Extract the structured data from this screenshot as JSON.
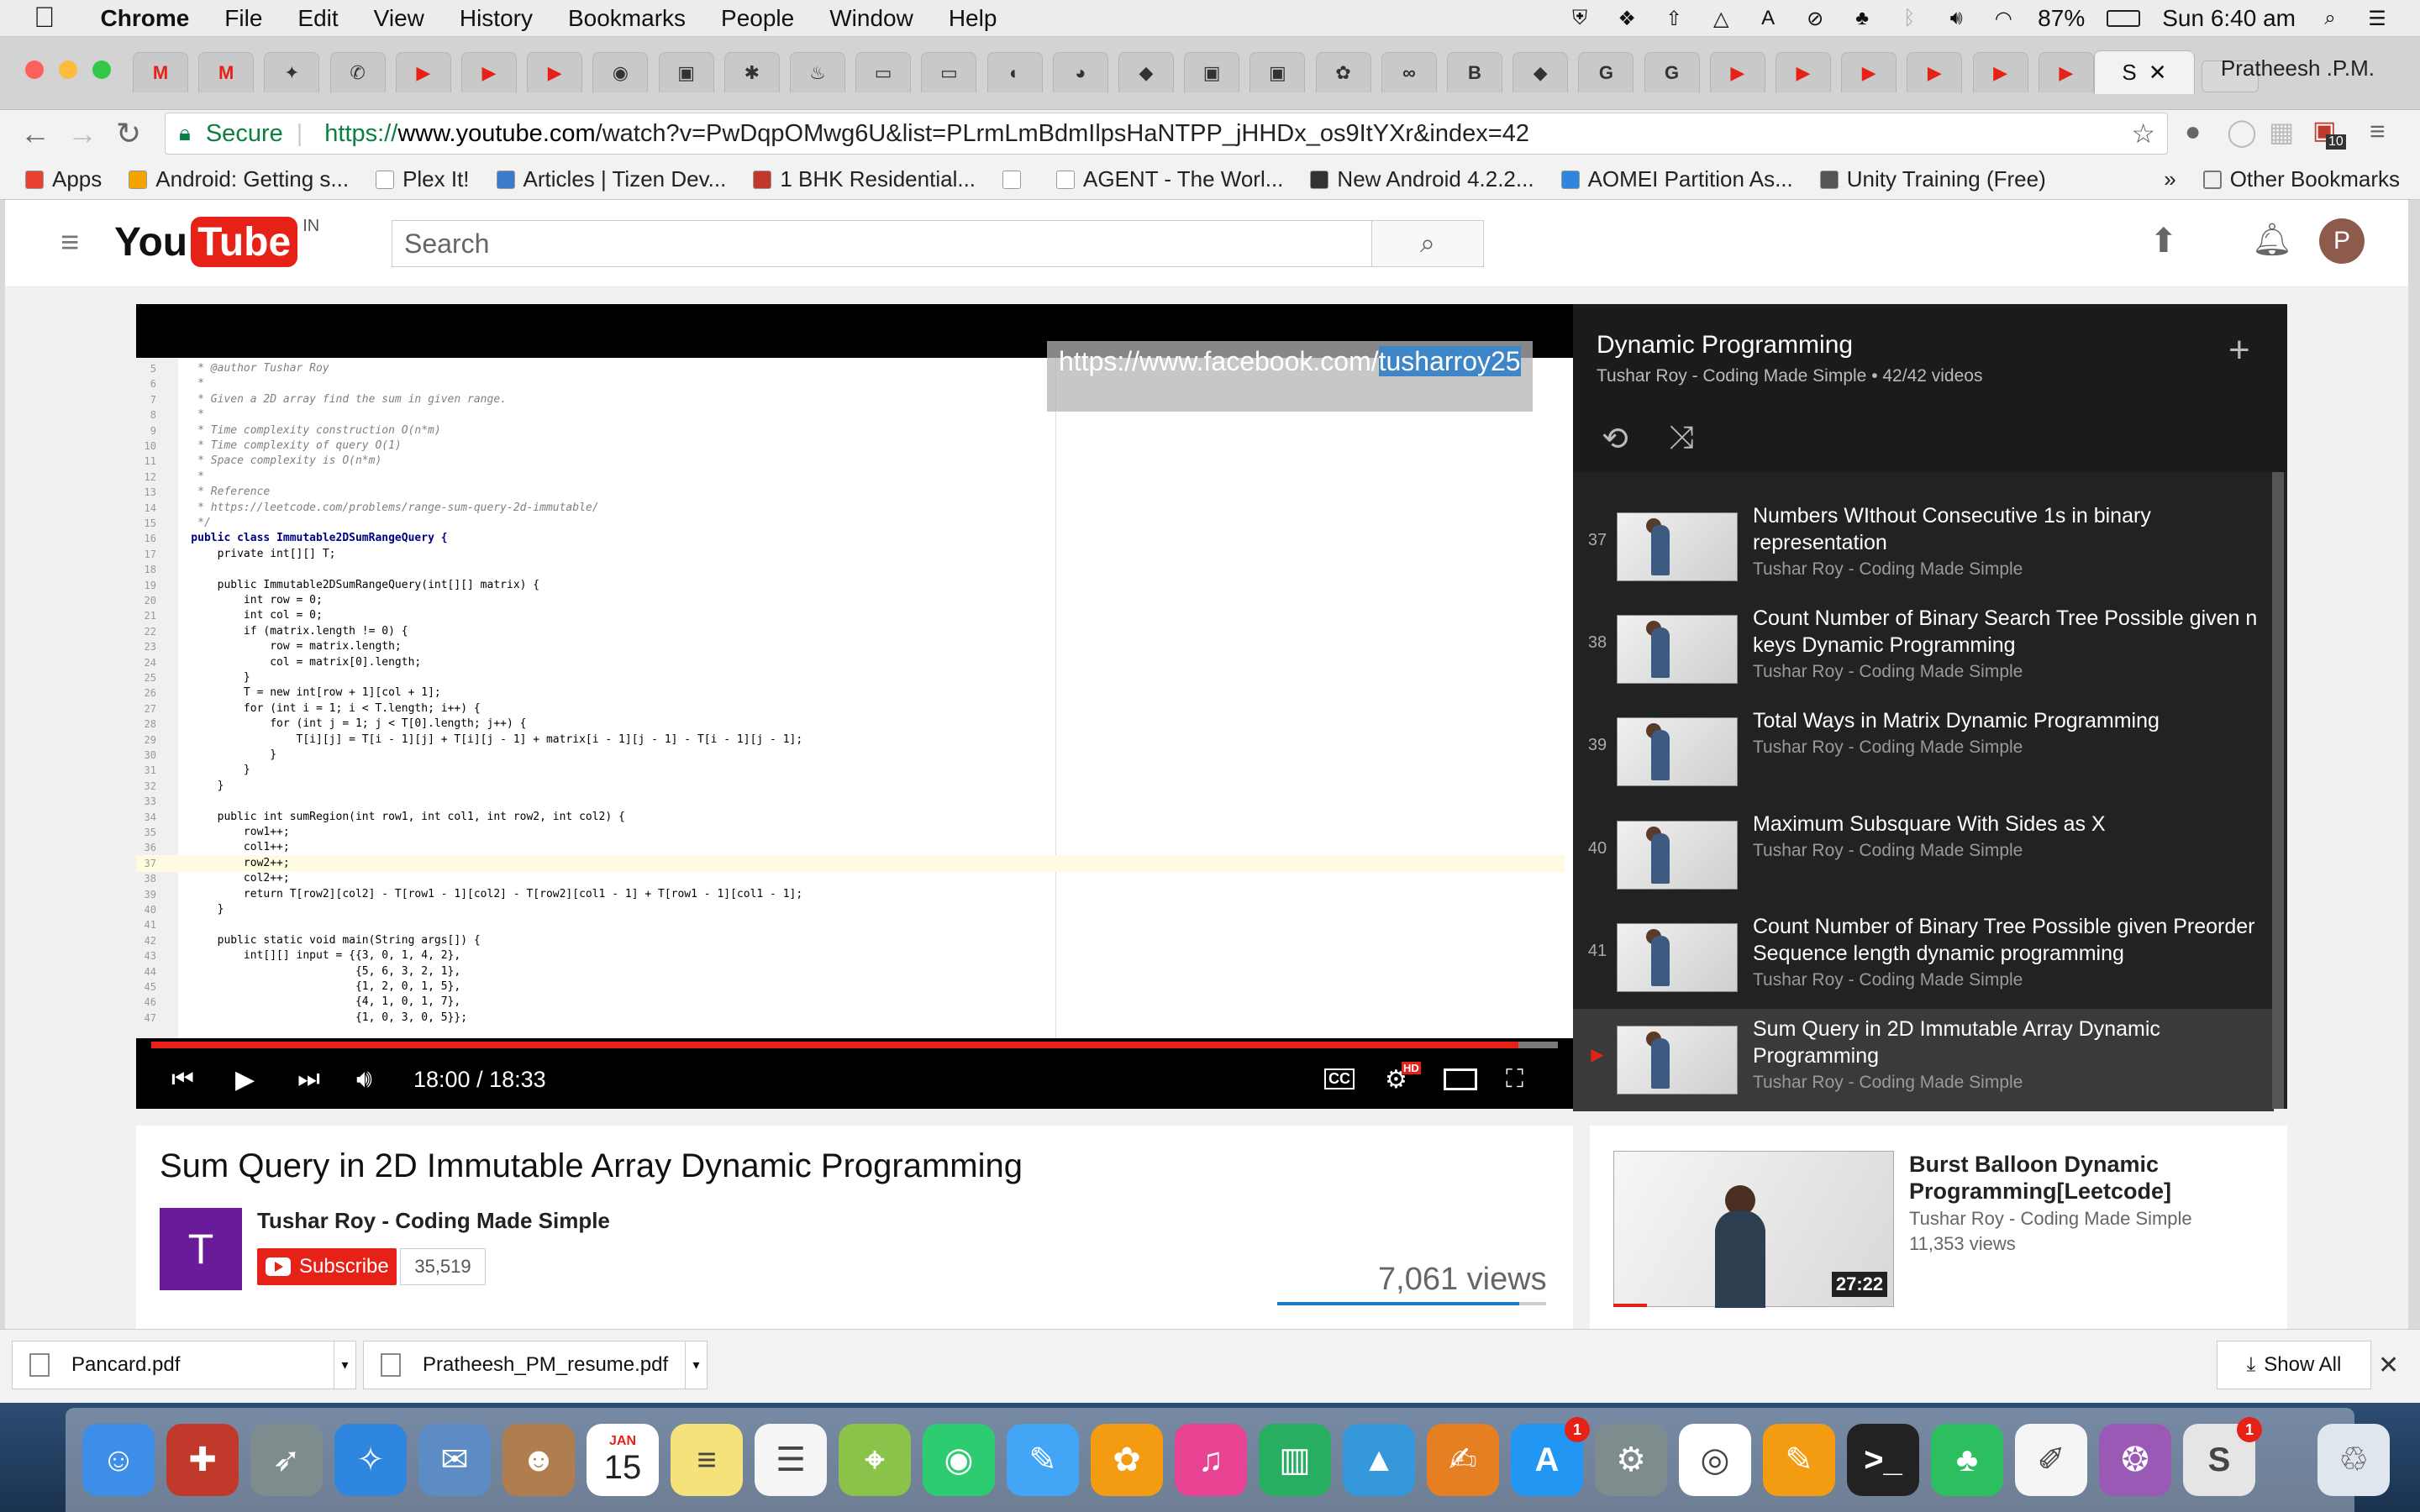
{
  "menubar": {
    "app": "Chrome",
    "items": [
      "File",
      "Edit",
      "View",
      "History",
      "Bookmarks",
      "People",
      "Window",
      "Help"
    ],
    "battery": "87%",
    "clock": "Sun 6:40 am"
  },
  "browser": {
    "active_tab_label": "S",
    "profile": "Pratheesh .P.M.",
    "pinned_tabs": [
      "M",
      "M",
      "✦",
      "✆",
      "▶",
      "▶",
      "▶",
      "◉",
      "▣",
      "✱",
      "♨",
      "▭",
      "▭",
      "◐",
      "◕",
      "◆",
      "▣",
      "▣",
      "✿",
      "∞",
      "B",
      "◆",
      "G",
      "G",
      "▶",
      "▶",
      "▶",
      "▶",
      "▶",
      "▶",
      "▶"
    ],
    "secure_label": "Secure",
    "url_scheme": "https://",
    "url_host": "www.youtube.com",
    "url_path": "/watch?v=PwDqpOMwg6U&list=PLrmLmBdmIlpsHaNTPP_jHHDx_os9ItYXr&index=42",
    "ext_badge": "10"
  },
  "bookmarks": {
    "items": [
      {
        "label": "Apps",
        "color": "#e94235"
      },
      {
        "label": "Android: Getting s...",
        "color": "#f4a300"
      },
      {
        "label": "Plex It!",
        "color": "#ffffff"
      },
      {
        "label": "Articles | Tizen Dev...",
        "color": "#3b7bc8"
      },
      {
        "label": "1 BHK Residential...",
        "color": "#c0392b"
      },
      {
        "label": "",
        "color": "#ffffff"
      },
      {
        "label": "AGENT - The Worl...",
        "color": "#ffffff"
      },
      {
        "label": "New Android 4.2.2...",
        "color": "#333333"
      },
      {
        "label": "AOMEI Partition As...",
        "color": "#2e86de"
      },
      {
        "label": "Unity Training (Free)",
        "color": "#555555"
      }
    ],
    "overflow": "»",
    "other": "Other Bookmarks"
  },
  "youtube": {
    "logo_you": "You",
    "logo_tube": "Tube",
    "region": "IN",
    "search_placeholder": "Search",
    "user_initial": "P"
  },
  "player": {
    "overlay_url_prefix": "https://www.facebook.com/",
    "overlay_url_selected": "tusharroy25",
    "time_current": "18:00",
    "time_total": "18:33",
    "progress": 0.972,
    "hd_badge": "HD",
    "cc_label": "CC"
  },
  "code": {
    "lines": [
      {
        "n": "5",
        "t": "     * @author Tushar Roy",
        "c": "cm"
      },
      {
        "n": "6",
        "t": "     *",
        "c": "cm"
      },
      {
        "n": "7",
        "t": "     * Given a 2D array find the sum in given range.",
        "c": "cm"
      },
      {
        "n": "8",
        "t": "     *",
        "c": "cm"
      },
      {
        "n": "9",
        "t": "     * Time complexity construction O(n*m)",
        "c": "cm"
      },
      {
        "n": "10",
        "t": "     * Time complexity of query O(1)",
        "c": "cm"
      },
      {
        "n": "11",
        "t": "     * Space complexity is O(n*m)",
        "c": "cm"
      },
      {
        "n": "12",
        "t": "     *",
        "c": "cm"
      },
      {
        "n": "13",
        "t": "     * Reference",
        "c": "cm"
      },
      {
        "n": "14",
        "t": "     * https://leetcode.com/problems/range-sum-query-2d-immutable/",
        "c": "cm"
      },
      {
        "n": "15",
        "t": "     */",
        "c": "cm"
      },
      {
        "n": "16",
        "t": "    public class Immutable2DSumRangeQuery {",
        "c": "kw"
      },
      {
        "n": "17",
        "t": "        private int[][] T;",
        "c": ""
      },
      {
        "n": "18",
        "t": "",
        "c": ""
      },
      {
        "n": "19",
        "t": "        public Immutable2DSumRangeQuery(int[][] matrix) {",
        "c": ""
      },
      {
        "n": "20",
        "t": "            int row = 0;",
        "c": ""
      },
      {
        "n": "21",
        "t": "            int col = 0;",
        "c": ""
      },
      {
        "n": "22",
        "t": "            if (matrix.length != 0) {",
        "c": ""
      },
      {
        "n": "23",
        "t": "                row = matrix.length;",
        "c": ""
      },
      {
        "n": "24",
        "t": "                col = matrix[0].length;",
        "c": ""
      },
      {
        "n": "25",
        "t": "            }",
        "c": ""
      },
      {
        "n": "26",
        "t": "            T = new int[row + 1][col + 1];",
        "c": ""
      },
      {
        "n": "27",
        "t": "            for (int i = 1; i < T.length; i++) {",
        "c": ""
      },
      {
        "n": "28",
        "t": "                for (int j = 1; j < T[0].length; j++) {",
        "c": ""
      },
      {
        "n": "29",
        "t": "                    T[i][j] = T[i - 1][j] + T[i][j - 1] + matrix[i - 1][j - 1] - T[i - 1][j - 1];",
        "c": ""
      },
      {
        "n": "30",
        "t": "                }",
        "c": ""
      },
      {
        "n": "31",
        "t": "            }",
        "c": ""
      },
      {
        "n": "32",
        "t": "        }",
        "c": ""
      },
      {
        "n": "33",
        "t": "",
        "c": ""
      },
      {
        "n": "34",
        "t": "        public int sumRegion(int row1, int col1, int row2, int col2) {",
        "c": ""
      },
      {
        "n": "35",
        "t": "            row1++;",
        "c": ""
      },
      {
        "n": "36",
        "t": "            col1++;",
        "c": ""
      },
      {
        "n": "37",
        "t": "            row2++;",
        "c": ""
      },
      {
        "n": "38",
        "t": "            col2++;",
        "c": ""
      },
      {
        "n": "39",
        "t": "            return T[row2][col2] - T[row1 - 1][col2] - T[row2][col1 - 1] + T[row1 - 1][col1 - 1];",
        "c": ""
      },
      {
        "n": "40",
        "t": "        }",
        "c": ""
      },
      {
        "n": "41",
        "t": "",
        "c": ""
      },
      {
        "n": "42",
        "t": "        public static void main(String args[]) {",
        "c": ""
      },
      {
        "n": "43",
        "t": "            int[][] input = {{3, 0, 1, 4, 2},",
        "c": ""
      },
      {
        "n": "44",
        "t": "                             {5, 6, 3, 2, 1},",
        "c": ""
      },
      {
        "n": "45",
        "t": "                             {1, 2, 0, 1, 5},",
        "c": ""
      },
      {
        "n": "46",
        "t": "                             {4, 1, 0, 1, 7},",
        "c": ""
      },
      {
        "n": "47",
        "t": "                             {1, 0, 3, 0, 5}};",
        "c": ""
      }
    ]
  },
  "playlist": {
    "title": "Dynamic Programming",
    "subtitle": "Tushar Roy - Coding Made Simple • 42/42 videos",
    "items": [
      {
        "num": "37",
        "title": "Numbers WIthout Consecutive 1s in binary representation",
        "author": "Tushar Roy - Coding Made Simple",
        "current": false
      },
      {
        "num": "38",
        "title": "Count Number of Binary Search Tree Possible given n keys Dynamic Programming",
        "author": "Tushar Roy - Coding Made Simple",
        "current": false
      },
      {
        "num": "39",
        "title": "Total Ways in Matrix Dynamic Programming",
        "author": "Tushar Roy - Coding Made Simple",
        "current": false
      },
      {
        "num": "40",
        "title": "Maximum Subsquare With Sides as X",
        "author": "Tushar Roy - Coding Made Simple",
        "current": false
      },
      {
        "num": "41",
        "title": "Count Number of Binary Tree Possible given Preorder Sequence length dynamic programming",
        "author": "Tushar Roy - Coding Made Simple",
        "current": false
      },
      {
        "num": "▶",
        "title": "Sum Query in 2D Immutable Array Dynamic Programming",
        "author": "Tushar Roy - Coding Made Simple",
        "current": true
      }
    ]
  },
  "video": {
    "title": "Sum Query in 2D Immutable Array Dynamic Programming",
    "avatar_letter": "T",
    "channel": "Tushar Roy - Coding Made Simple",
    "subscribe_label": "Subscribe",
    "subscriber_count": "35,519",
    "views": "7,061 views",
    "like_ratio": 0.9
  },
  "related": {
    "title": "Burst Balloon Dynamic Programming[Leetcode]",
    "channel": "Tushar Roy - Coding Made Simple",
    "views": "11,353 views",
    "duration": "27:22"
  },
  "downloads": {
    "files": [
      "Pancard.pdf",
      "Pratheesh_PM_resume.pdf"
    ],
    "show_all": "Show All"
  },
  "dock": {
    "calendar_month": "JAN",
    "calendar_day": "15",
    "appstore_badge": "1",
    "slack_badge": "1",
    "icons": [
      {
        "name": "finder-icon",
        "color": "#3d8ee8",
        "glyph": "☺"
      },
      {
        "name": "security-icon",
        "color": "#c0392b",
        "glyph": "✚"
      },
      {
        "name": "launchpad-icon",
        "color": "#7f8c8d",
        "glyph": "➶"
      },
      {
        "name": "safari-icon",
        "color": "#2e86de",
        "glyph": "✧"
      },
      {
        "name": "mail-icon",
        "color": "#5d8bc3",
        "glyph": "✉"
      },
      {
        "name": "contacts-icon",
        "color": "#b07d4f",
        "glyph": "☻"
      },
      {
        "name": "calendar-icon",
        "color": "#ffffff",
        "glyph": ""
      },
      {
        "name": "notes-icon",
        "color": "#f6e27a",
        "glyph": "≡"
      },
      {
        "name": "reminders-icon",
        "color": "#f5f5f5",
        "glyph": "☰"
      },
      {
        "name": "maps-icon",
        "color": "#8bc34a",
        "glyph": "⌖"
      },
      {
        "name": "facetime-icon",
        "color": "#2ecc71",
        "glyph": "◉"
      },
      {
        "name": "messages-icon",
        "color": "#42a5f5",
        "glyph": "✎"
      },
      {
        "name": "photos-icon",
        "color": "#f39c12",
        "glyph": "✿"
      },
      {
        "name": "itunes-icon",
        "color": "#e84393",
        "glyph": "♫"
      },
      {
        "name": "numbers-icon",
        "color": "#27ae60",
        "glyph": "▥"
      },
      {
        "name": "keynote-icon",
        "color": "#3498db",
        "glyph": "▲"
      },
      {
        "name": "ibooks-icon",
        "color": "#e67e22",
        "glyph": "✍"
      },
      {
        "name": "appstore-icon",
        "color": "#2196f3",
        "glyph": "A"
      },
      {
        "name": "system-preferences-icon",
        "color": "#7f8c8d",
        "glyph": "⚙"
      },
      {
        "name": "chrome-icon",
        "color": "#ffffff",
        "glyph": "◎"
      },
      {
        "name": "pages-icon",
        "color": "#f39c12",
        "glyph": "✎"
      },
      {
        "name": "terminal-icon",
        "color": "#222222",
        "glyph": ">_"
      },
      {
        "name": "evernote-icon",
        "color": "#2dbe60",
        "glyph": "♣"
      },
      {
        "name": "textedit-icon",
        "color": "#f5f5f5",
        "glyph": "✐"
      },
      {
        "name": "molecule-icon",
        "color": "#9b59b6",
        "glyph": "❂"
      },
      {
        "name": "slack-icon",
        "color": "#e5e5e5",
        "glyph": "S"
      },
      {
        "name": "trash-icon",
        "color": "#dfe6ee",
        "glyph": "♲"
      }
    ]
  }
}
